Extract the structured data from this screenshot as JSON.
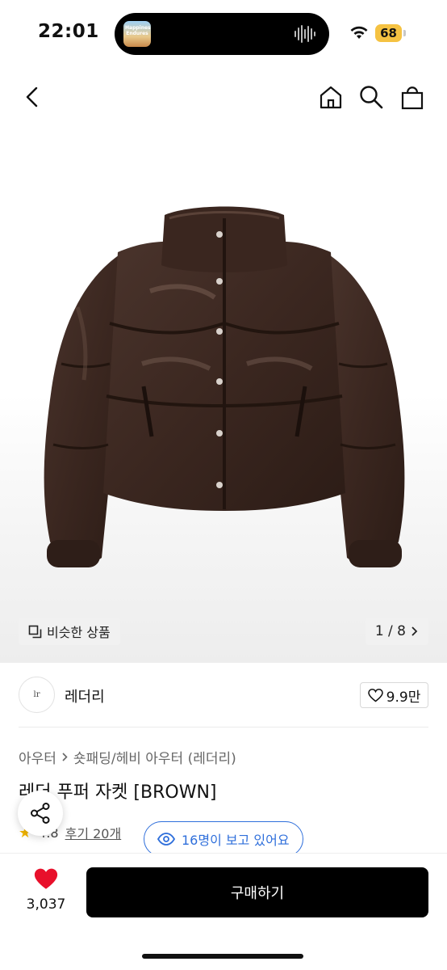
{
  "status_bar": {
    "time": "22:01",
    "battery": "68",
    "now_playing_art_text": "Happiness Endures"
  },
  "nav": {
    "back_icon": "chevron-left-icon",
    "home_icon": "home-icon",
    "search_icon": "search-icon",
    "cart_icon": "shopping-bag-icon"
  },
  "hero": {
    "similar_label": "비슷한 상품",
    "pager_text": "1 / 8"
  },
  "brand": {
    "name": "레더리",
    "avatar_text": "lr",
    "likes": "9.9만"
  },
  "product": {
    "breadcrumb_1": "아우터",
    "breadcrumb_2": "숏패딩/헤비 아우터 (레더리)",
    "title": "레더 푸퍼 자켓 [BROWN]",
    "rating": "4.8",
    "reviews": "후기 20개",
    "viewers": "16명이 보고 있어요"
  },
  "bottom_bar": {
    "wishlist_count": "3,037",
    "buy_label": "구매하기"
  },
  "colors": {
    "accent_blue": "#2f6fdb",
    "heart_red": "#e8102b",
    "star": "#f3b600",
    "jacket_brown": "#3b2720"
  }
}
